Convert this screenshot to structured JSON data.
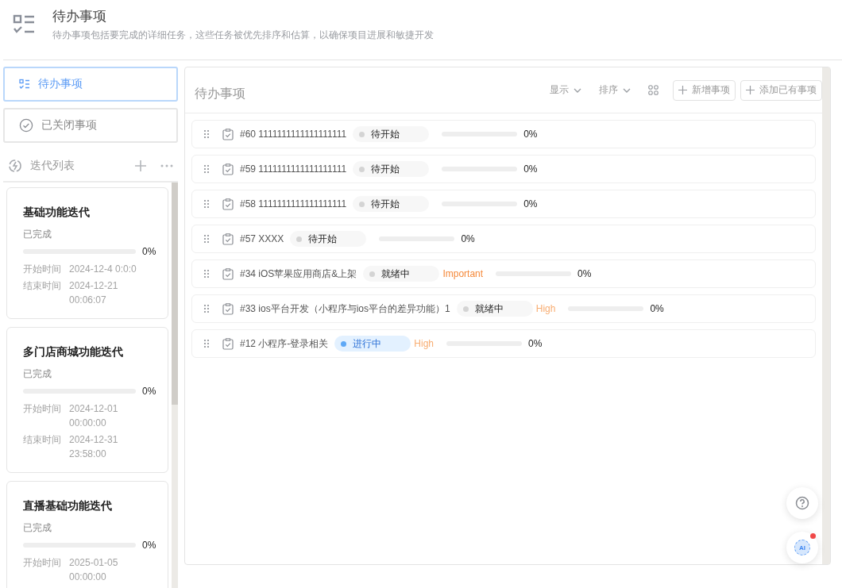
{
  "header": {
    "title": "待办事项",
    "description": "待办事项包括要完成的详细任务，这些任务被优先排序和估算，以确保项目进展和敏捷开发"
  },
  "nav": [
    {
      "label": "待办事项",
      "selected": true
    },
    {
      "label": "已关闭事项",
      "selected": false
    }
  ],
  "iterations": {
    "title": "迭代列表",
    "items": [
      {
        "name": "基础功能迭代",
        "status": "已完成",
        "level": 0,
        "reading": "0%",
        "start_label": "开始时间",
        "start": "2024-12-4 0:0:0",
        "end_label": "结束时间",
        "end": "2024-12-21 00:06:07"
      },
      {
        "name": "多门店商城功能迭代",
        "status": "已完成",
        "level": 0,
        "reading": "0%",
        "start_label": "开始时间",
        "start": "2024-12-01 00:00:00",
        "end_label": "结束时间",
        "end": "2024-12-31 23:58:00"
      },
      {
        "name": "直播基础功能迭代",
        "status": "已完成",
        "level": 0,
        "reading": "0%",
        "start_label": "开始时间",
        "start": "2025-01-05 00:00:00"
      }
    ]
  },
  "panel": {
    "title": "待办事项",
    "toolbar": {
      "display": "显示",
      "sort": "排序",
      "new_button": "新增事项",
      "add_button": "添加已有事项"
    },
    "rows": [
      {
        "title": "#60 1111111111111111111",
        "status": {
          "label": "待开始",
          "kind": "idle"
        },
        "level": 0,
        "reading": "0%"
      },
      {
        "title": "#59 1111111111111111111",
        "status": {
          "label": "待开始",
          "kind": "idle"
        },
        "level": 0,
        "reading": "0%"
      },
      {
        "title": "#58 1111111111111111111",
        "status": {
          "label": "待开始",
          "kind": "idle"
        },
        "level": 0,
        "reading": "0%"
      },
      {
        "title": "#57 XXXX",
        "status": {
          "label": "待开始",
          "kind": "idle"
        },
        "level": 0,
        "reading": "0%"
      },
      {
        "title": "#34 iOS苹果应用商店&上架",
        "status": {
          "label": "就绪中",
          "kind": "idle"
        },
        "priority": {
          "label": "Important",
          "color": "#f5893a"
        },
        "level": 0,
        "reading": "0%"
      },
      {
        "title": "#33 ios平台开发（小程序与ios平台的差异功能）1",
        "status": {
          "label": "就绪中",
          "kind": "idle"
        },
        "priority": {
          "label": "High",
          "color": "#f8ad72"
        },
        "level": 0,
        "reading": "0%"
      },
      {
        "title": "#12 小程序-登录相关",
        "status": {
          "label": "进行中",
          "kind": "active"
        },
        "priority": {
          "label": "High",
          "color": "#f8ad72"
        },
        "level": 0,
        "reading": "0%"
      }
    ]
  },
  "ai_button": {
    "label": "AI",
    "unread": true
  }
}
